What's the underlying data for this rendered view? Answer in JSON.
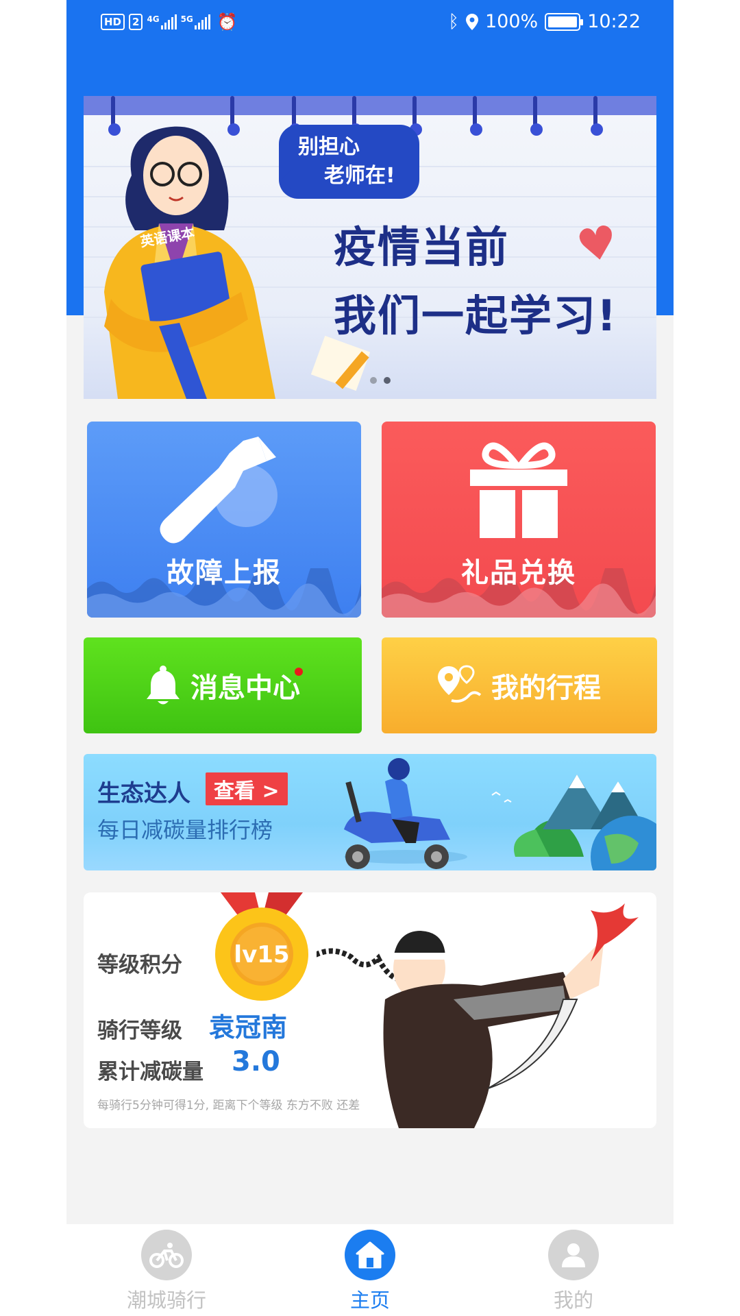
{
  "status_bar": {
    "left_icons": [
      "HD",
      "2",
      "4G",
      "5G",
      "alarm-icon"
    ],
    "battery": "100%",
    "time": "10:22"
  },
  "banner": {
    "bubble_line1": "别担心",
    "bubble_line2": "老师在!",
    "headline1": "疫情当前",
    "headline2": "我们一起学习!",
    "book_label": "英语课本",
    "current_slide": 2,
    "slide_count": 2
  },
  "tiles": {
    "repair": {
      "label": "故障上报",
      "icon": "wrench-icon",
      "color": "#4a8cf4"
    },
    "gift": {
      "label": "礼品兑换",
      "icon": "gift-icon",
      "color": "#f5505a"
    },
    "messages": {
      "label": "消息中心",
      "icon": "bell-icon",
      "has_unread": true,
      "color": "#4fd018"
    },
    "trips": {
      "label": "我的行程",
      "icon": "route-pin-icon",
      "color": "#fbbf38"
    }
  },
  "eco": {
    "title": "生态达人",
    "button": "查看 >",
    "subtitle": "每日减碳量排行榜"
  },
  "level": {
    "points_label": "等级积分",
    "medal_level": "lv15",
    "rank_label": "骑行等级",
    "rank_value": "袁冠南",
    "carbon_label": "累计减碳量",
    "carbon_value": "3.0",
    "note": "每骑行5分钟可得1分, 距离下个等级 东方不败 还差"
  },
  "nav": {
    "items": [
      {
        "label": "潮城骑行",
        "icon": "bike-icon",
        "active": false
      },
      {
        "label": "主页",
        "icon": "home-icon",
        "active": true
      },
      {
        "label": "我的",
        "icon": "user-icon",
        "active": false
      }
    ]
  },
  "colors": {
    "header_blue": "#1a73f0",
    "accent_blue": "#1b7df0"
  }
}
